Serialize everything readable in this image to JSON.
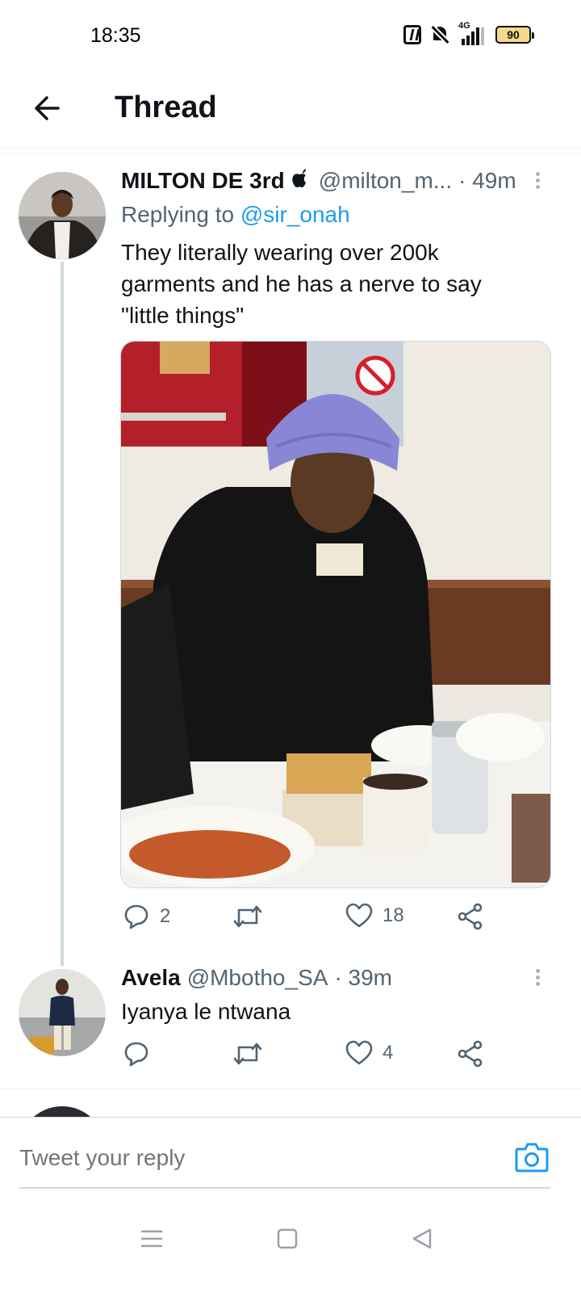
{
  "status_bar": {
    "time": "18:35",
    "network": "4G",
    "battery": "90",
    "icons": [
      "nfc-icon",
      "bell-off-icon",
      "signal-icon",
      "battery-icon"
    ]
  },
  "header": {
    "title": "Thread",
    "back_icon": "arrow-left-icon"
  },
  "tweets": [
    {
      "name": "MILTON DE 3rd",
      "handle": "@milton_m...",
      "time": "· 49m",
      "replying_prefix": "Replying to ",
      "replying_to": "@sir_onah",
      "text_lines": [
        "They literally wearing over 200k",
        "garments and he has a nerve to say",
        "\"little things\""
      ],
      "stats": {
        "replies": "2",
        "retweets": "",
        "likes": "18"
      }
    },
    {
      "name": "Avela",
      "handle": "@Mbotho_SA",
      "time": "· 39m",
      "text": "Iyanya le ntwana",
      "stats": {
        "replies": "",
        "retweets": "",
        "likes": "4"
      }
    }
  ],
  "reply_box": {
    "placeholder": "Tweet your reply",
    "camera_icon": "camera-icon"
  },
  "nav": [
    "menu-icon",
    "home-square-icon",
    "back-triangle-icon"
  ],
  "colors": {
    "accent": "#1d9bf0",
    "secondary_text": "#536471",
    "thread_line": "#cfd9de"
  }
}
